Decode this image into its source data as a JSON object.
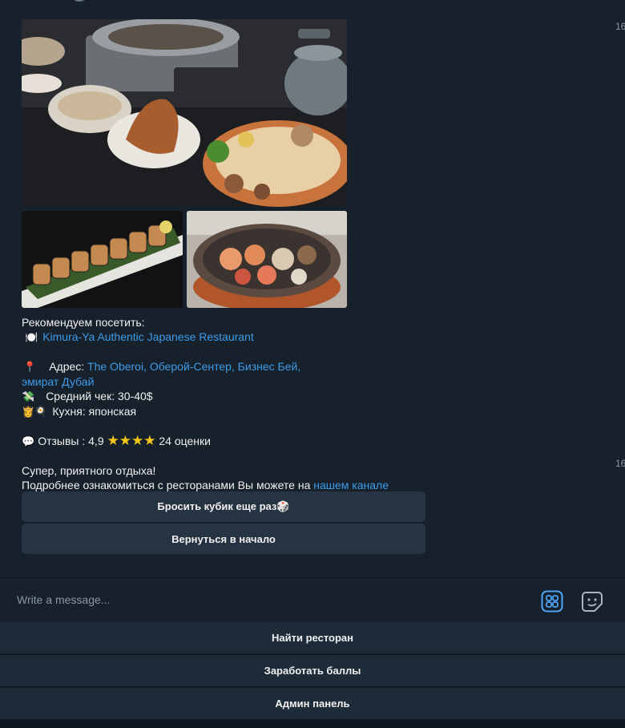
{
  "message": {
    "time_top": "16",
    "time_bottom": "16",
    "recommend_title": "Рекомендуем посетить:",
    "restaurant_emoji": "🍽️",
    "restaurant_name": "Kimura-Ya Authentic Japanese Restaurant",
    "address_emoji": "📍",
    "address_label": "Адрес:",
    "address_value_line1": "The Oberoi, Оберой-Сентер, Бизнес Бей,",
    "address_value_line2": "эмират Дубай",
    "check_emoji": "💸",
    "check_label": "Средний чек: 30-40$",
    "cuisine_emoji": "👸🍳",
    "cuisine_label": "Кухня: японская",
    "reviews_emoji": "💬",
    "reviews_label": "Отзывы : 4,9",
    "stars": "★★★★",
    "reviews_count": "24 оценки",
    "closing_line": "Супер, приятного отдыха!",
    "details_prefix": "Подробнее ознакомиться с ресторанами Вы можете на",
    "details_link": "нашем канале"
  },
  "inline_keyboard": {
    "roll_again": "Бросить кубик еще раз🎲",
    "back_to_start": "Вернуться в начало"
  },
  "composer": {
    "placeholder": "Write a message...",
    "commands_icon": "bot-commands-icon",
    "sticker_icon": "sticker-icon"
  },
  "reply_keyboard": {
    "find_restaurant": "Найти ресторан",
    "earn_points": "Заработать баллы",
    "admin_panel": "Админ панель"
  },
  "colors": {
    "background": "#17212b",
    "link": "#3d9be9",
    "button": "#253342",
    "accent": "#4ea4f5"
  }
}
